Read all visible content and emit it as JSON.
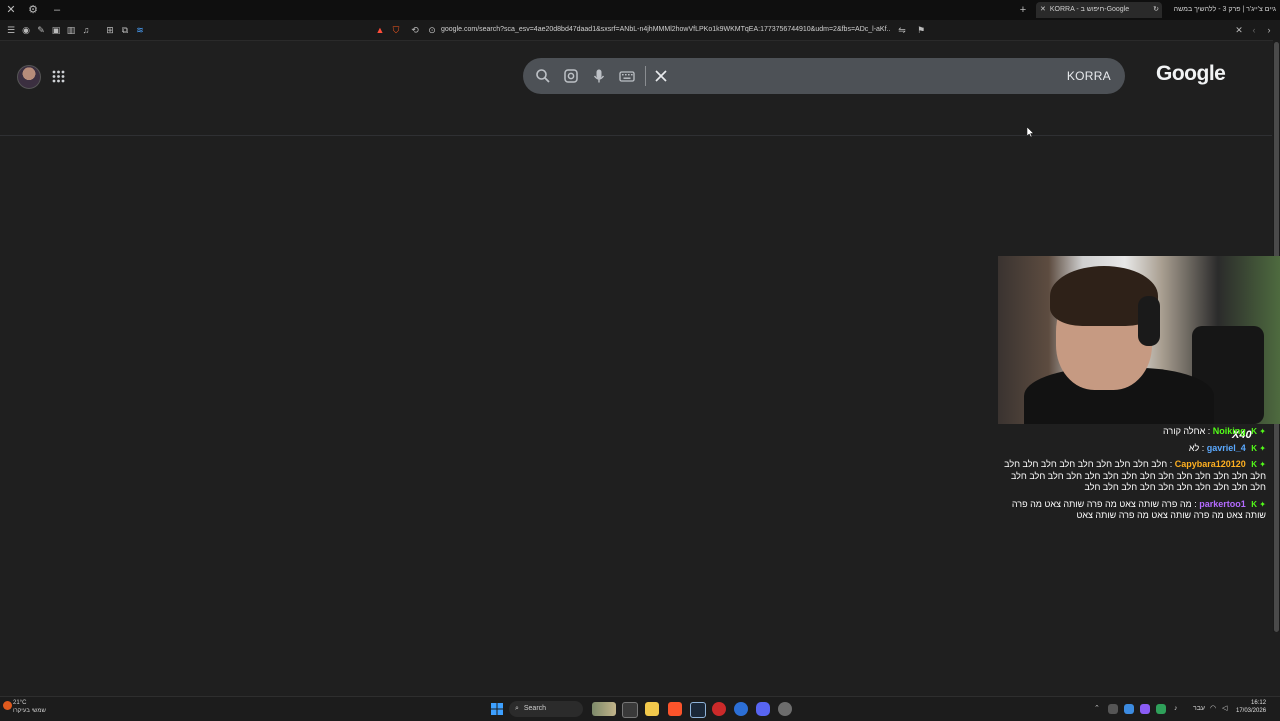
{
  "titlebar": {
    "tabs": [
      {
        "label": "KORRA - חיפוש ב-Google",
        "active": true
      },
      {
        "label": "גיים צ'ייג'ר | פרק 3 - ללהשיך במשה"
      }
    ]
  },
  "address_bar": {
    "url": "google.com/search?sca_esv=4ae20d8bd47daad1&sxsrf=ANbL-n4jhMMMl2howVfLPKo1k9WKMTqEA:1773756744910&udm=2&fbs=ADc_l-aKf..."
  },
  "google": {
    "query": "KORRA",
    "logo": "Google"
  },
  "stream_overlay": {
    "badge": "X40",
    "chat": [
      {
        "badges": "K ✦",
        "username": "Noiking",
        "user_color": "#53fc18",
        "sep": " : ",
        "text": "אחלה קורה"
      },
      {
        "badges": "K ✦",
        "username": "gavriel_4",
        "user_color": "#5aa9ff",
        "sep": " : ",
        "text": "לא"
      },
      {
        "badges": "K ✦",
        "username": "Capybara120120",
        "user_color": "#ffb020",
        "sep": " : ",
        "text": "חלב חלב חלב חלב חלב חלב חלב חלב חלב חלב חלב חלב חלב חלב חלב חלב חלב חלב חלב חלב חלב חלב חלב חלב חלב חלב חלב חלב חלב חלב חלב חלב חלב"
      },
      {
        "badges": "K ✦",
        "username": "parkertoo1",
        "user_color": "#b46bff",
        "sep": " : ",
        "text": "מה פרה שותה צאט מה פרה שותה צאט מה פרה שותה צאט מה פרה שותה צאט מה פרה שותה צאט"
      }
    ]
  },
  "taskbar": {
    "weather_temp": "21°C",
    "weather_desc": "שמשי בעיקרו",
    "search_label": "Search",
    "tray_lang": "עבר",
    "time": "16:12",
    "date": "17/03/2026"
  },
  "colors": {
    "page_bg": "#1f1f1f",
    "searchbox_bg": "#4d5156",
    "kick_green": "#53fc18"
  }
}
